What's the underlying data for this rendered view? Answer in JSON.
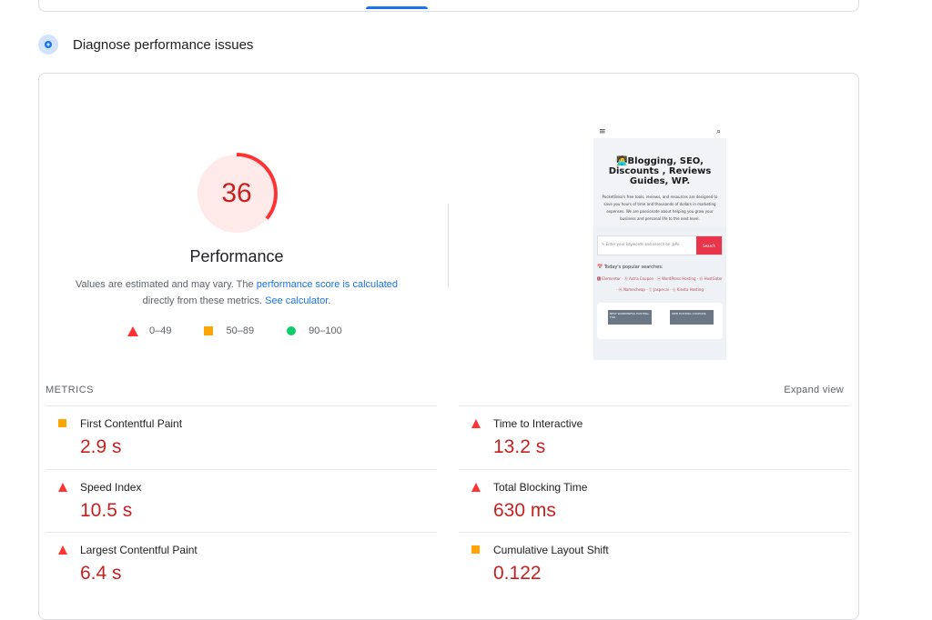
{
  "section": {
    "title": "Diagnose performance issues",
    "icon": "diagnose-icon"
  },
  "gauge": {
    "score": "36",
    "fraction": 0.36,
    "label": "Performance",
    "color": "#ff3333"
  },
  "note": {
    "text1": "Values are estimated and may vary. The ",
    "link1": "performance score is calculated",
    "text2": " directly from these metrics. ",
    "link2": "See calculator."
  },
  "legend": [
    {
      "range": "0–49",
      "shape": "triangle",
      "color": "#ff3333"
    },
    {
      "range": "50–89",
      "shape": "square",
      "color": "#ffa400"
    },
    {
      "range": "90–100",
      "shape": "circle",
      "color": "#0cce6b"
    }
  ],
  "screenshot": {
    "menu_icon": "≡",
    "search_icon": "⌕",
    "heading": "🧑‍💻Blogging, SEO, Discounts , Reviews Guides, WP.",
    "description": "Pocketlinko's free tools, reviews, and resources are designed to save you hours of time and thousands of dollars in marketing expenses. We are passionate about helping you grow your business and personal life to the next level.",
    "search_placeholder": "✎ Enter your keywords and search on @Po",
    "search_button": "Search",
    "popular_title": "📅 Today's popular searches:",
    "tags": "🅴 Elementor · Ⓐ Astra Coupon · ⓦ WordPress Hosting · Ⓗ HostGator · Ⓝ Namecheap · ⓙ Jasper.ai · ⓚ Kinsta Hosting",
    "card1": "BEST WORDPRESS HOSTING FOR",
    "card2": "WEB HOSTING COUPONS"
  },
  "metrics": {
    "heading": "METRICS",
    "expand": "Expand view",
    "items": [
      {
        "label": "First Contentful Paint",
        "value": "2.9 s",
        "rating": "average"
      },
      {
        "label": "Time to Interactive",
        "value": "13.2 s",
        "rating": "fail"
      },
      {
        "label": "Speed Index",
        "value": "10.5 s",
        "rating": "fail"
      },
      {
        "label": "Total Blocking Time",
        "value": "630 ms",
        "rating": "fail"
      },
      {
        "label": "Largest Contentful Paint",
        "value": "6.4 s",
        "rating": "fail"
      },
      {
        "label": "Cumulative Layout Shift",
        "value": "0.122",
        "rating": "average"
      }
    ]
  },
  "colors": {
    "fail": "#ff3333",
    "average": "#ffa400",
    "pass": "#0cce6b",
    "link": "#1a73e8",
    "value": "#c5221f"
  }
}
